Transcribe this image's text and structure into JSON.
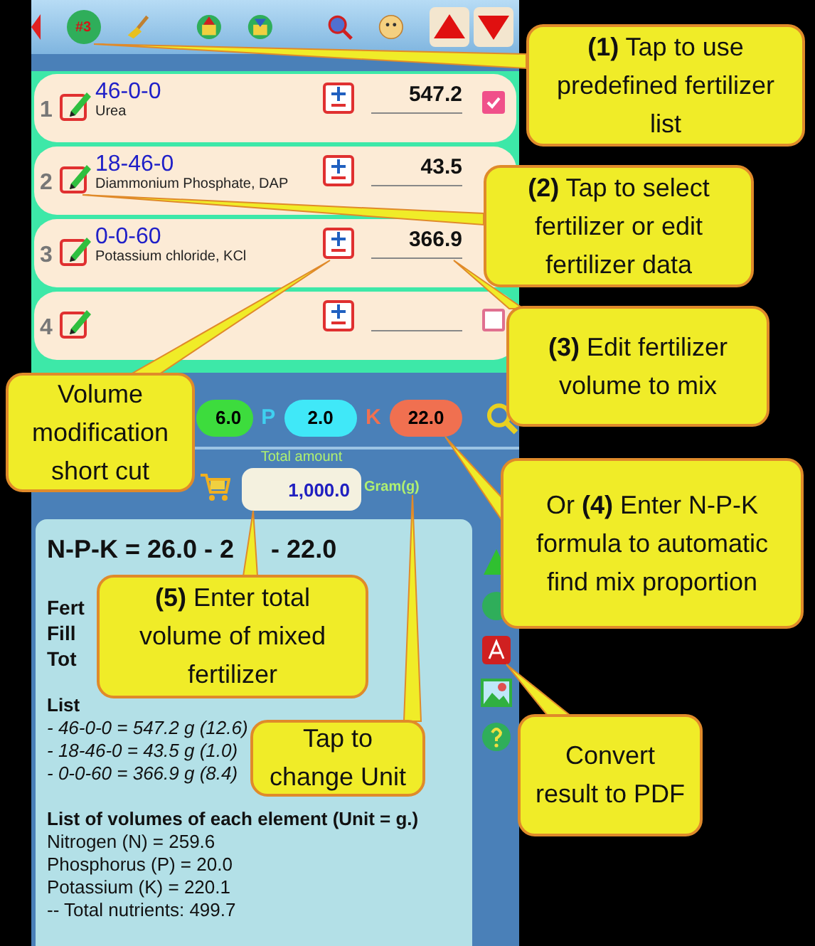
{
  "toolbar": {
    "preset_badge": "#3"
  },
  "rows": [
    {
      "index": "1",
      "formula": "46-0-0",
      "name": "Urea",
      "amount": "547.2",
      "checked": true
    },
    {
      "index": "2",
      "formula": "18-46-0",
      "name": "Diammonium Phosphate, DAP",
      "amount": "43.5"
    },
    {
      "index": "3",
      "formula": "0-0-60",
      "name": "Potassium chloride, KCl",
      "amount": "366.9"
    },
    {
      "index": "4",
      "formula": "",
      "name": "",
      "amount": "",
      "checked": false
    }
  ],
  "npk_bar": {
    "n_value": "6.0",
    "p_label": "P",
    "p_value": "2.0",
    "k_label": "K",
    "k_value": "22.0"
  },
  "total": {
    "label": "Total amount",
    "value": "1,000.0",
    "unit": "Gram(g)"
  },
  "result": {
    "formula_parts": [
      "N-P-K = 26.0 - 2",
      "- 22.0"
    ],
    "summary_fragments": [
      "Fert",
      "Fill",
      "Tot"
    ],
    "in_use_heading": "List",
    "in_use_items": [
      "- 46-0-0 = 547.2 g (12.6)",
      "- 18-46-0 = 43.5 g (1.0)",
      "- 0-0-60 = 366.9 g (8.4)"
    ],
    "volumes_heading": "List of volumes of each element (Unit = g.)",
    "volumes": [
      "Nitrogen (N) = 259.6",
      "Phosphorus (P) = 20.0",
      "Potassium (K) = 220.1",
      "-- Total nutrients: 499.7"
    ]
  },
  "callouts": [
    {
      "text": "**(1)** Tap to use predefined fertilizer list"
    },
    {
      "text": "**(2)** Tap to select fertilizer or edit fertilizer data"
    },
    {
      "text": "**(3)** Edit fertilizer volume to mix"
    },
    {
      "text": "Volume modification short cut"
    },
    {
      "text": "Or **(4)** Enter N-P-K formula to automatic find mix proportion"
    },
    {
      "text": "**(5)** Enter total volume of mixed fertilizer"
    },
    {
      "text": "Tap to change Unit"
    },
    {
      "text": "Convert result to PDF"
    }
  ]
}
